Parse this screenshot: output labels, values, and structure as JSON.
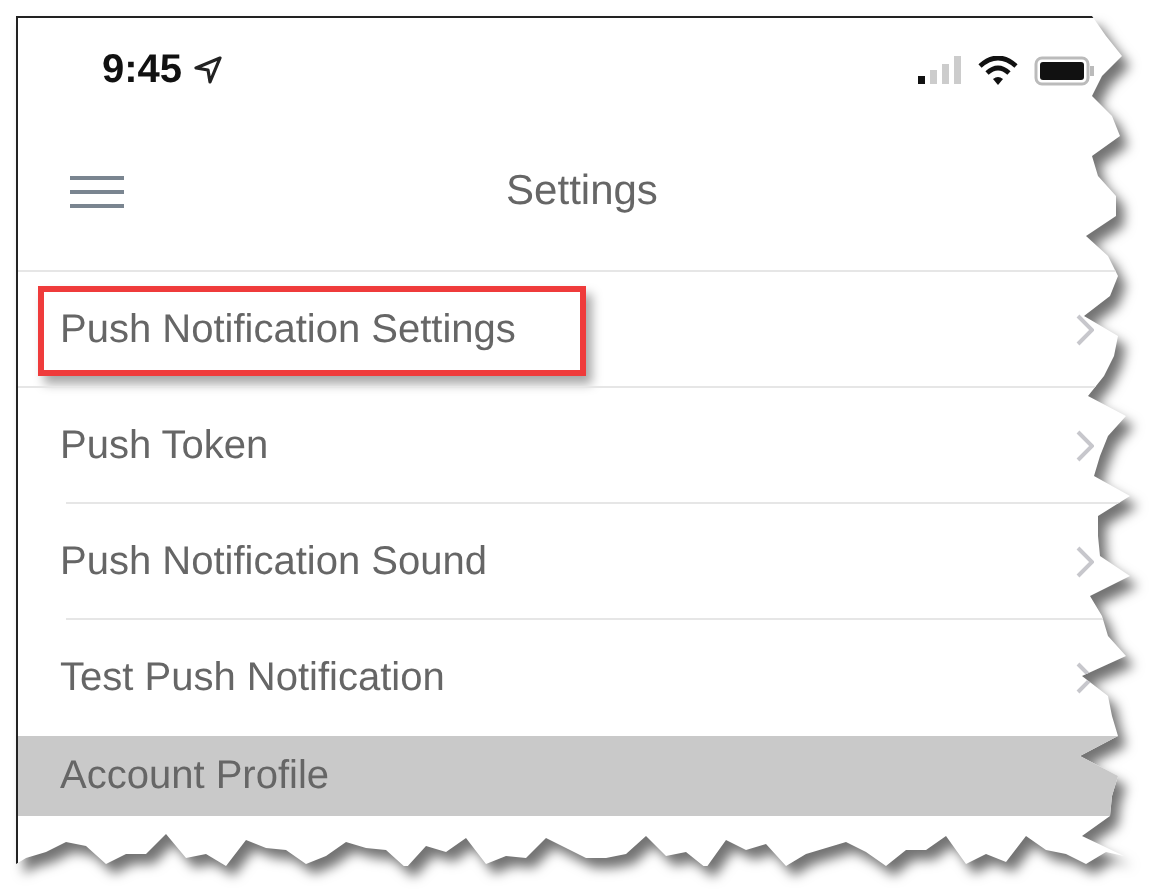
{
  "status_bar": {
    "time": "9:45"
  },
  "nav_bar": {
    "title": "Settings"
  },
  "items": [
    {
      "label": "Push Notification Settings",
      "highlighted": true
    },
    {
      "label": "Push Token",
      "highlighted": false
    },
    {
      "label": "Push Notification Sound",
      "highlighted": false
    },
    {
      "label": "Test Push Notification",
      "highlighted": false
    }
  ],
  "section_header": {
    "label": "Account Profile"
  }
}
